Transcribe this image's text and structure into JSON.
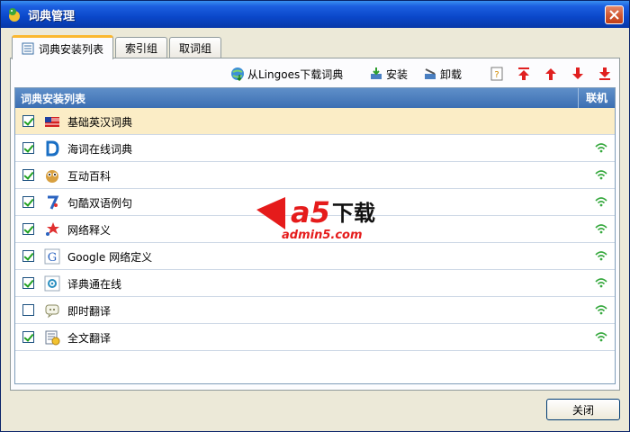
{
  "window": {
    "title": "词典管理",
    "close_symbol": "×"
  },
  "tabs": [
    {
      "label": "词典安装列表",
      "active": true
    },
    {
      "label": "索引组",
      "active": false
    },
    {
      "label": "取词组",
      "active": false
    }
  ],
  "toolbar": {
    "download_label": "从Lingoes下载词典",
    "install_label": "安装",
    "uninstall_label": "卸载"
  },
  "list": {
    "col_name": "词典安装列表",
    "col_online": "联机",
    "rows": [
      {
        "name": "基础英汉词典",
        "checked": true,
        "online": false,
        "icon": "flag-icon",
        "selected": true
      },
      {
        "name": "海词在线词典",
        "checked": true,
        "online": true,
        "icon": "dict-d-icon",
        "selected": false
      },
      {
        "name": "互动百科",
        "checked": true,
        "online": true,
        "icon": "owl-icon",
        "selected": false
      },
      {
        "name": "句酷双语例句",
        "checked": true,
        "online": true,
        "icon": "jukuu-icon",
        "selected": false
      },
      {
        "name": "网络释义",
        "checked": true,
        "online": true,
        "icon": "stars-icon",
        "selected": false
      },
      {
        "name": "Google 网络定义",
        "checked": true,
        "online": true,
        "icon": "google-g-icon",
        "selected": false
      },
      {
        "name": "译典通在线",
        "checked": true,
        "online": true,
        "icon": "dr-eye-icon",
        "selected": false
      },
      {
        "name": "即时翻译",
        "checked": false,
        "online": true,
        "icon": "chat-icon",
        "selected": false
      },
      {
        "name": "全文翻译",
        "checked": true,
        "online": true,
        "icon": "doc-translate-icon",
        "selected": false
      }
    ]
  },
  "watermark": {
    "brand": "a5",
    "text": "下载",
    "site": "admin5.com"
  },
  "footer": {
    "close_label": "关闭"
  }
}
